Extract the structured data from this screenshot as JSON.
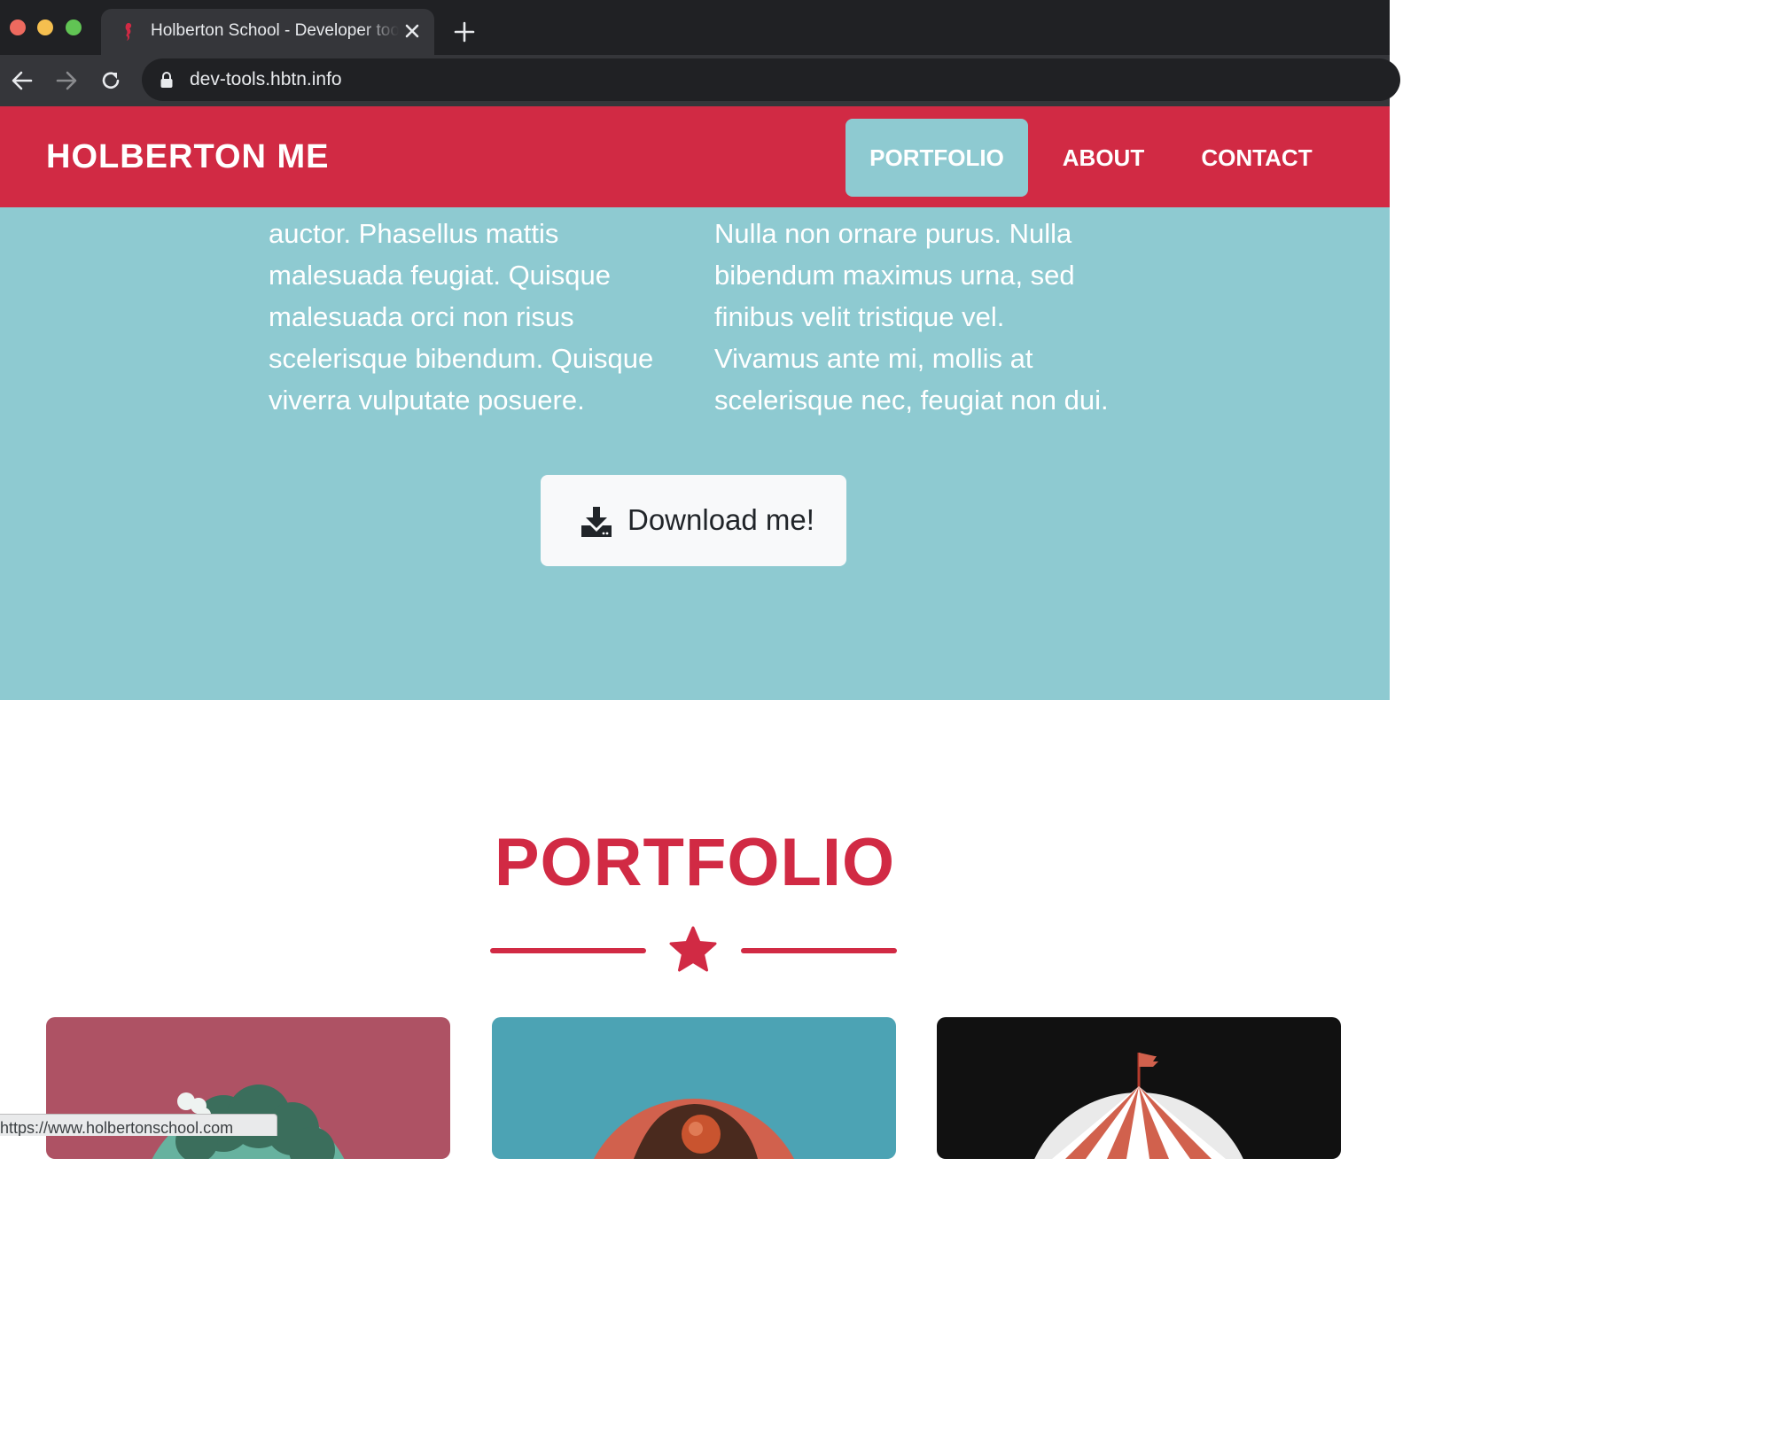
{
  "browser": {
    "tab_title": "Holberton School - Developer tools",
    "url": "dev-tools.hbtn.info",
    "status_url": "https://www.holbertonschool.com"
  },
  "navbar": {
    "brand": "HOLBERTON ME",
    "items": [
      {
        "label": "PORTFOLIO",
        "active": true
      },
      {
        "label": "ABOUT",
        "active": false
      },
      {
        "label": "CONTACT",
        "active": false
      }
    ]
  },
  "about": {
    "left_column": "auctor. Phasellus mattis malesuada feugiat. Quisque malesuada orci non risus scelerisque bibendum. Quisque viverra vulputate posuere.",
    "right_column": "Nulla non ornare purus. Nulla bibendum maximus urna, sed finibus velit tristique vel. Vivamus ante mi, mollis at scelerisque nec, feugiat non dui.",
    "download_label": "Download me!",
    "download_icon": "download-icon"
  },
  "portfolio": {
    "title": "PORTFOLIO",
    "divider_icon": "star-icon",
    "cards": [
      {
        "illustration": "cabin-icon",
        "background": "#ae5264"
      },
      {
        "illustration": "cake-icon",
        "background": "#4ca3b4"
      },
      {
        "illustration": "circus-tent-icon",
        "background": "#111111"
      }
    ]
  },
  "colors": {
    "primary_red": "#d12a44",
    "teal": "#8ecad1",
    "browser_dark": "#202124"
  }
}
